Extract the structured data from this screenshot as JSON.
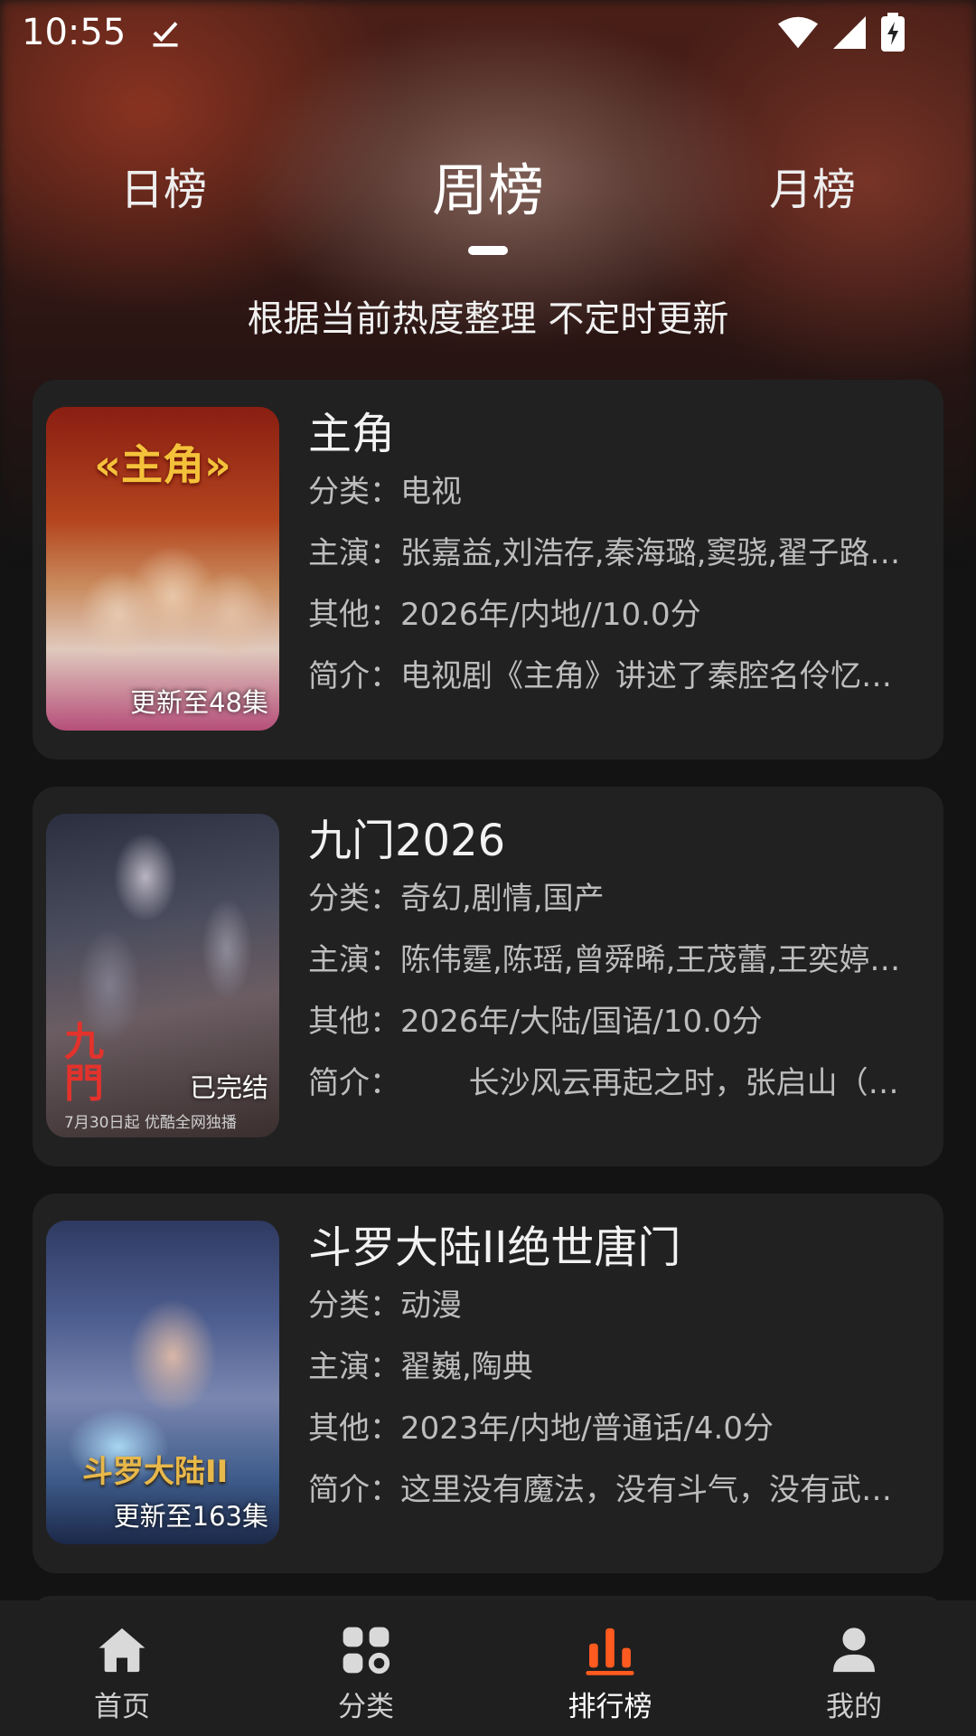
{
  "status": {
    "time": "10:55"
  },
  "tabs": [
    {
      "label": "日榜"
    },
    {
      "label": "周榜"
    },
    {
      "label": "月榜"
    }
  ],
  "subtitle": "根据当前热度整理 不定时更新",
  "cards": [
    {
      "title": "主角",
      "badge": "更新至48集",
      "category": "分类：电视",
      "cast": "主演：张嘉益,刘浩存,秦海璐,窦骁,翟子路,…",
      "other": "其他：2026年/内地//10.0分",
      "intro": "简介：电视剧《主角》讲述了秦腔名伶忆…",
      "poster_title": "«主角»"
    },
    {
      "title": "九门2026",
      "badge": "已完结",
      "category": "分类：奇幻,剧情,国产",
      "cast": "主演：陈伟霆,陈瑶,曾舜晞,王茂蕾,王奕婷,…",
      "other": "其他：2026年/大陆/国语/10.0分",
      "intro": "简介：       长沙风云再起之时，张启山（…",
      "poster_title": "九門",
      "poster_caption": "7月30日起 优酷全网独播"
    },
    {
      "title": "斗罗大陆II绝世唐门",
      "badge": "更新至163集",
      "category": "分类：动漫",
      "cast": "主演：翟巍,陶典",
      "other": "其他：2023年/内地/普通话/4.0分",
      "intro": "简介：这里没有魔法，没有斗气，没有武…",
      "poster_title": "斗罗大陆II"
    }
  ],
  "nav": [
    {
      "label": "首页",
      "icon": "home-icon"
    },
    {
      "label": "分类",
      "icon": "category-icon"
    },
    {
      "label": "排行榜",
      "icon": "ranking-icon"
    },
    {
      "label": "我的",
      "icon": "profile-icon"
    }
  ],
  "colors": {
    "accent": "#ff5a1f",
    "card_bg": "#212121",
    "nav_bg": "#1f1f1f"
  }
}
